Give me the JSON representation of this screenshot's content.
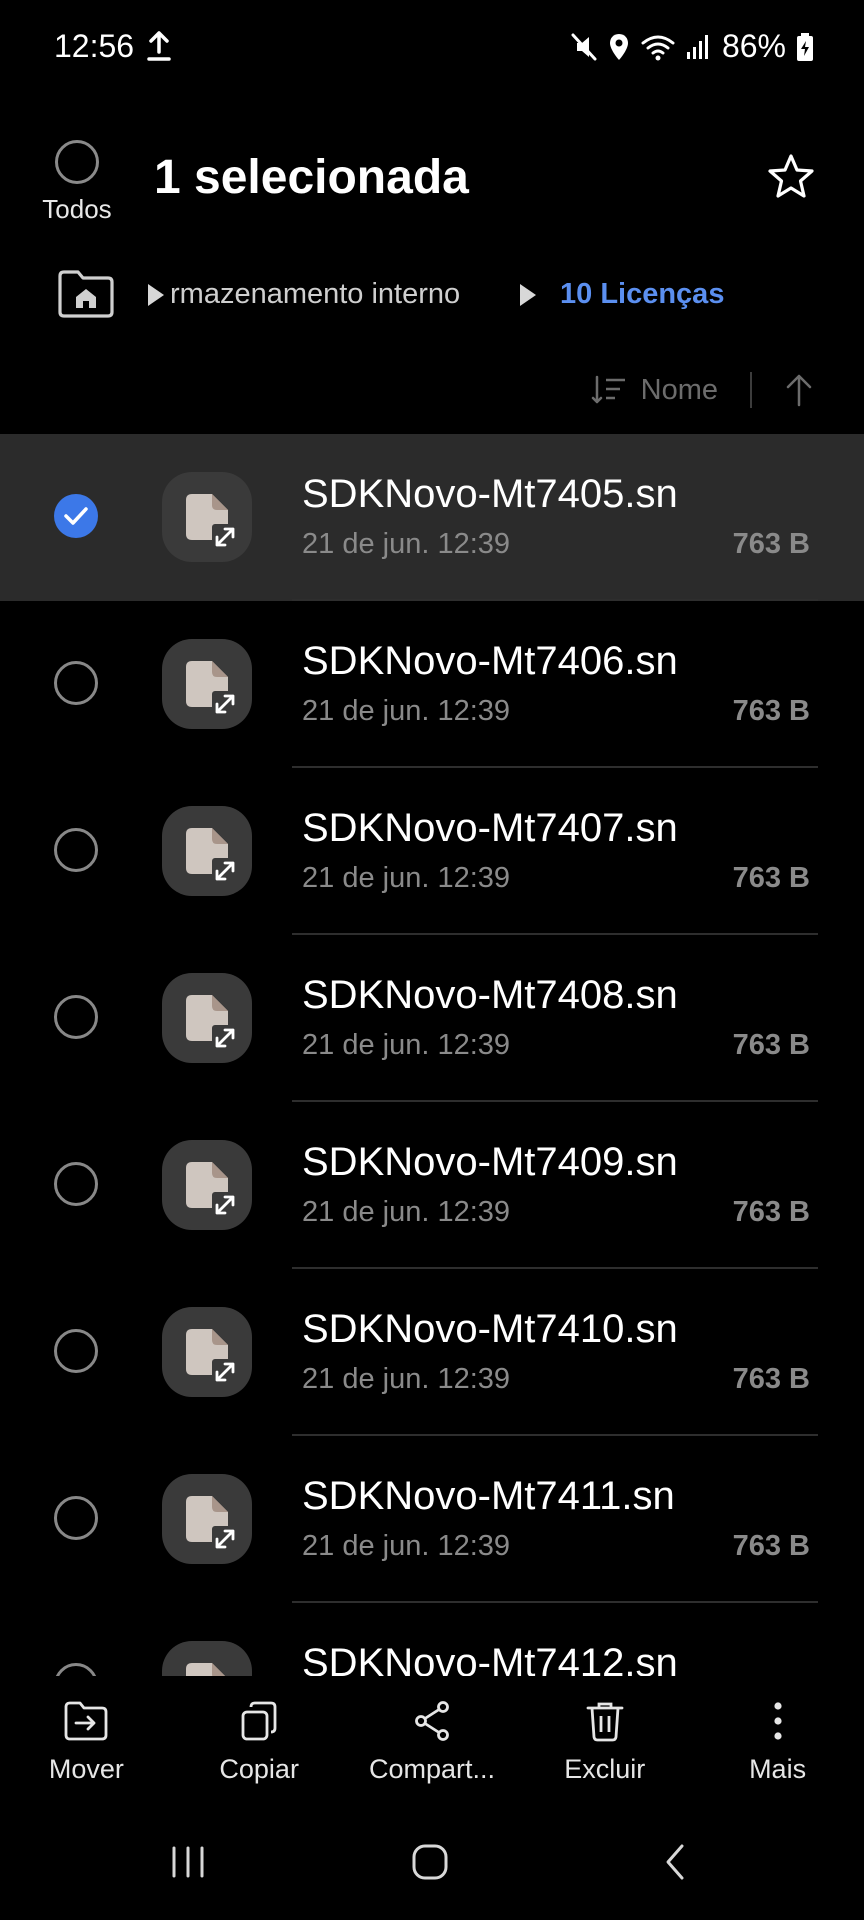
{
  "status_bar": {
    "time": "12:56",
    "battery": "86%",
    "icons": [
      "upload-icon",
      "mute-icon",
      "location-icon",
      "wifi-icon",
      "signal-icon",
      "battery-icon"
    ]
  },
  "header": {
    "select_all_label": "Todos",
    "title": "1 selecionada"
  },
  "breadcrumb": {
    "parent": "rmazenamento interno",
    "current": "10 Licenças"
  },
  "sort": {
    "label": "Nome"
  },
  "files": [
    {
      "name": "SDKNovo-Mt7405.sn",
      "date": "21 de jun. 12:39",
      "size": "763 B",
      "selected": true
    },
    {
      "name": "SDKNovo-Mt7406.sn",
      "date": "21 de jun. 12:39",
      "size": "763 B",
      "selected": false
    },
    {
      "name": "SDKNovo-Mt7407.sn",
      "date": "21 de jun. 12:39",
      "size": "763 B",
      "selected": false
    },
    {
      "name": "SDKNovo-Mt7408.sn",
      "date": "21 de jun. 12:39",
      "size": "763 B",
      "selected": false
    },
    {
      "name": "SDKNovo-Mt7409.sn",
      "date": "21 de jun. 12:39",
      "size": "763 B",
      "selected": false
    },
    {
      "name": "SDKNovo-Mt7410.sn",
      "date": "21 de jun. 12:39",
      "size": "763 B",
      "selected": false
    },
    {
      "name": "SDKNovo-Mt7411.sn",
      "date": "21 de jun. 12:39",
      "size": "763 B",
      "selected": false
    },
    {
      "name": "SDKNovo-Mt7412.sn",
      "date": "",
      "size": "",
      "selected": false
    }
  ],
  "toolbar": {
    "move": "Mover",
    "copy": "Copiar",
    "share": "Compart...",
    "delete": "Excluir",
    "more": "Mais"
  },
  "colors": {
    "accent": "#3c78e8",
    "breadcrumb_current": "#5b8ff0",
    "selected_row": "#2b2b2b"
  }
}
